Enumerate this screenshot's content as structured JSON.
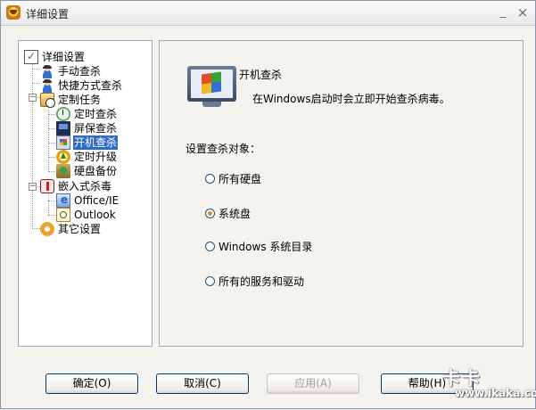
{
  "window": {
    "title": "详细设置",
    "controls": {
      "minimize": "_",
      "close": "×"
    }
  },
  "tree": {
    "items": [
      {
        "label": "详细设置",
        "icon": "settings-checklist-icon"
      },
      {
        "label": "手动查杀",
        "icon": "person-scan-icon"
      },
      {
        "label": "快捷方式查杀",
        "icon": "person-shortcut-icon"
      },
      {
        "label": "定制任务",
        "icon": "custom-task-icon"
      },
      {
        "label": "定时查杀",
        "icon": "clock-icon"
      },
      {
        "label": "屏保查杀",
        "icon": "screensaver-icon"
      },
      {
        "label": "开机查杀",
        "icon": "boot-scan-icon",
        "selected": true
      },
      {
        "label": "定时升级",
        "icon": "upgrade-icon"
      },
      {
        "label": "硬盘备份",
        "icon": "disk-backup-icon"
      },
      {
        "label": "嵌入式杀毒",
        "icon": "embedded-av-icon"
      },
      {
        "label": "Office/IE",
        "icon": "office-ie-icon"
      },
      {
        "label": "Outlook",
        "icon": "outlook-icon"
      },
      {
        "label": "其它设置",
        "icon": "other-settings-icon"
      }
    ]
  },
  "content": {
    "title": "开机查杀",
    "description": "在Windows启动时会立即开始查杀病毒。",
    "group_label": "设置查杀对象：",
    "options": [
      {
        "label": "所有硬盘",
        "checked": false
      },
      {
        "label": "系统盘",
        "checked": true
      },
      {
        "label": "Windows 系统目录",
        "checked": false
      },
      {
        "label": "所有的服务和驱动",
        "checked": false
      }
    ]
  },
  "buttons": {
    "ok": "确定(O)",
    "cancel": "取消(C)",
    "apply": "应用(A)",
    "help": "帮助(H)"
  },
  "watermark": {
    "brand": "卡卡",
    "url": "www.ikaka.com"
  }
}
